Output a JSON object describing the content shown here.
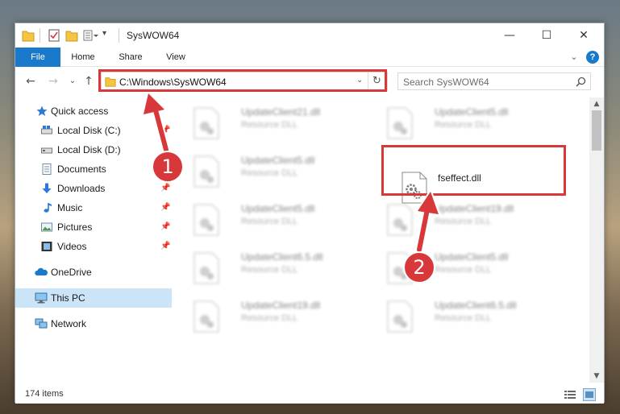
{
  "window": {
    "title": "SysWOW64",
    "minimize_glyph": "—",
    "maximize_glyph": "☐",
    "close_glyph": "✕"
  },
  "ribbon": {
    "tabs": [
      "File",
      "Home",
      "Share",
      "View"
    ],
    "expand_glyph": "⌄",
    "help_glyph": "?"
  },
  "nav": {
    "back_glyph": "←",
    "forward_glyph": "→",
    "recent_glyph": "⌄",
    "up_glyph": "↑",
    "address": "C:\\Windows\\SysWOW64",
    "address_dropdown_glyph": "⌄",
    "refresh_glyph": "↻",
    "search_placeholder": "Search SysWOW64",
    "search_glyph": "⚲"
  },
  "sidebar": {
    "items": [
      {
        "label": "Quick access",
        "icon": "star-icon"
      },
      {
        "label": "Local Disk (C:)",
        "icon": "drive-icon"
      },
      {
        "label": "Local Disk (D:)",
        "icon": "drive-icon"
      },
      {
        "label": "Documents",
        "icon": "documents-icon"
      },
      {
        "label": "Downloads",
        "icon": "download-icon"
      },
      {
        "label": "Music",
        "icon": "music-icon"
      },
      {
        "label": "Pictures",
        "icon": "pictures-icon"
      },
      {
        "label": "Videos",
        "icon": "videos-icon"
      },
      {
        "label": "OneDrive",
        "icon": "cloud-icon"
      },
      {
        "label": "This PC",
        "icon": "computer-icon"
      },
      {
        "label": "Network",
        "icon": "network-icon"
      }
    ],
    "pin_glyph": "📌"
  },
  "files": {
    "items": [
      {
        "name": "UpdateClient21.dll",
        "type": "Resource DLL"
      },
      {
        "name": "UpdateClient5.dll",
        "type": "Resource DLL"
      },
      {
        "name": "UpdateClient5.dll",
        "type": "Resource DLL"
      },
      {
        "name": "fseffect.dll",
        "type": ""
      },
      {
        "name": "UpdateClient5.dll",
        "type": "Resource DLL"
      },
      {
        "name": "UpdateClient19.dll",
        "type": "Resource DLL"
      },
      {
        "name": "UpdateClient6.5.dll",
        "type": "Resource DLL"
      },
      {
        "name": "UpdateClient5.dll",
        "type": "Resource DLL"
      },
      {
        "name": "UpdateClient19.dll",
        "type": "Resource DLL"
      },
      {
        "name": "UpdateClient6.5.dll",
        "type": "Resource DLL"
      }
    ]
  },
  "status": {
    "item_count": "174 items"
  },
  "callouts": {
    "step1": "1",
    "step2": "2"
  },
  "colors": {
    "accent": "#1979ca",
    "highlight": "#d9383a",
    "selected": "#cce4f7"
  }
}
